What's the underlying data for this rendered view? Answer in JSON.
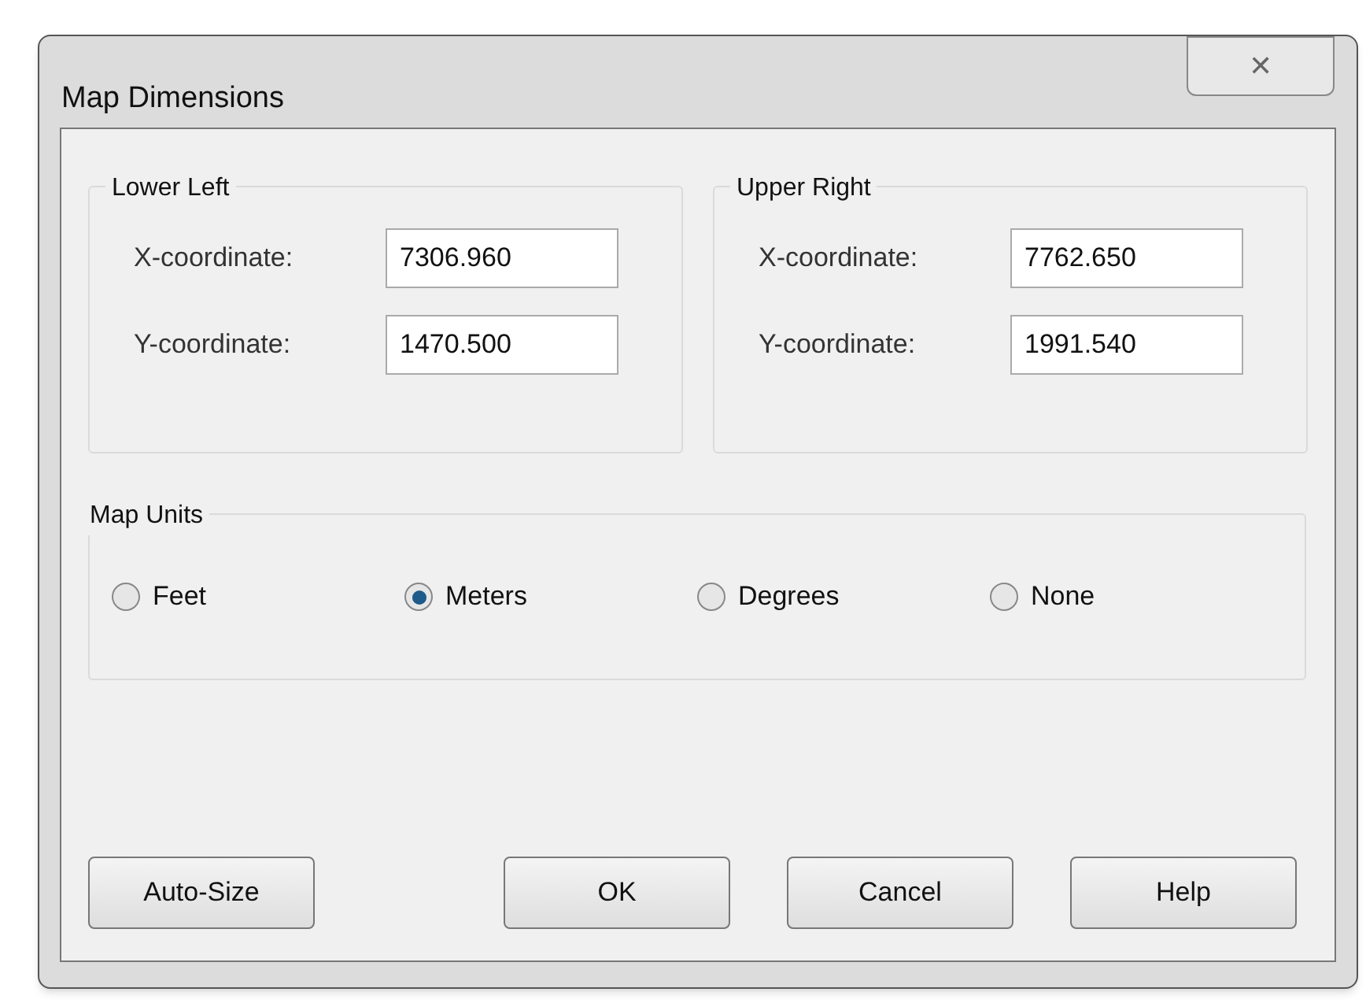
{
  "window": {
    "title": "Map Dimensions",
    "close": "✕"
  },
  "groups": [
    {
      "title": "Lower Left",
      "fields": [
        {
          "label": "X-coordinate:",
          "value": "7306.960"
        },
        {
          "label": "Y-coordinate:",
          "value": "1470.500"
        }
      ]
    },
    {
      "title": "Upper Right",
      "fields": [
        {
          "label": "X-coordinate:",
          "value": "7762.650"
        },
        {
          "label": "Y-coordinate:",
          "value": "1991.540"
        }
      ]
    }
  ],
  "map_units": {
    "title": "Map Units",
    "options": [
      {
        "label": "Feet",
        "selected": false
      },
      {
        "label": "Meters",
        "selected": true
      },
      {
        "label": "Degrees",
        "selected": false
      },
      {
        "label": "None",
        "selected": false
      }
    ]
  },
  "buttons": [
    "Auto-Size",
    "OK",
    "Cancel",
    "Help"
  ]
}
